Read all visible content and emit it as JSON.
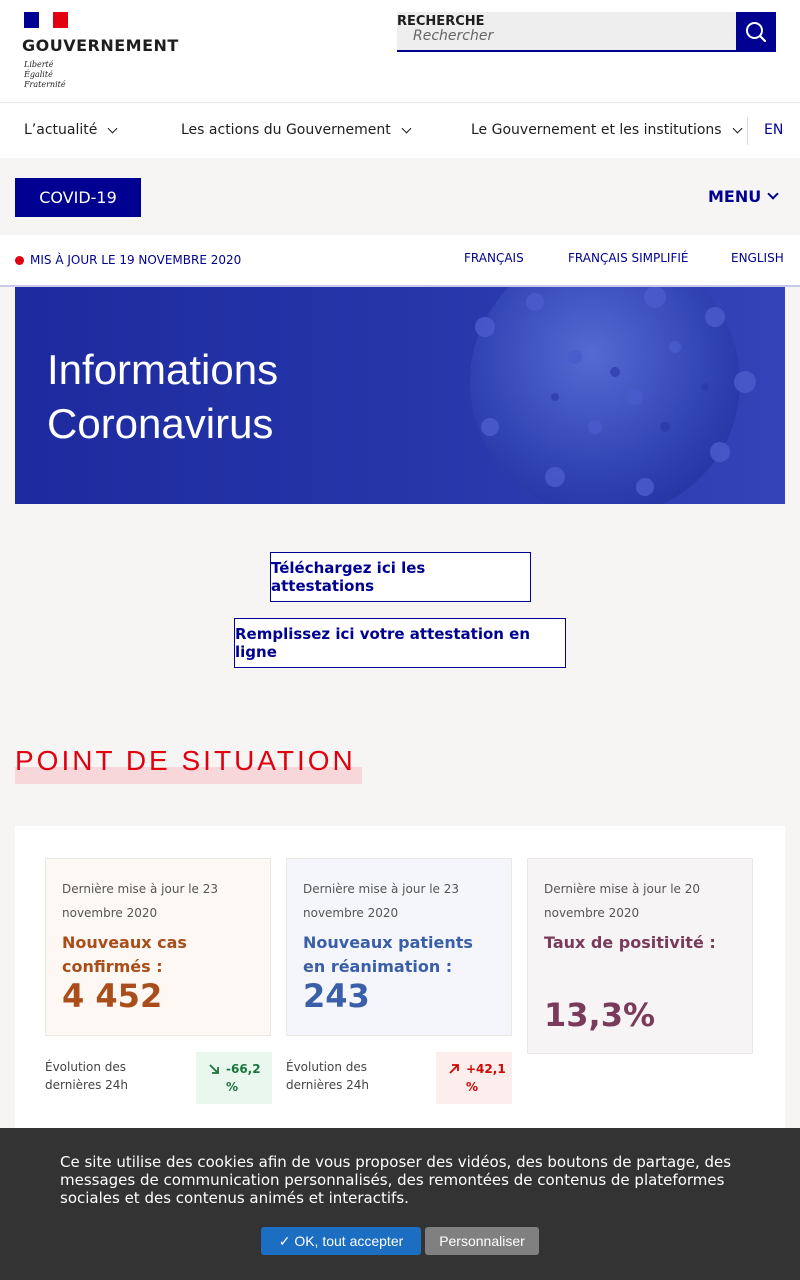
{
  "header": {
    "logo_title": "GOUVERNEMENT",
    "motto": [
      "Liberté",
      "Égalité",
      "Fraternité"
    ],
    "search_label": "RECHERCHE",
    "search_placeholder": "Rechercher"
  },
  "nav": {
    "items": [
      {
        "label": "L’actualité"
      },
      {
        "label": "Les actions du Gouvernement"
      },
      {
        "label": "Le Gouvernement et les institutions"
      }
    ],
    "lang": "EN"
  },
  "covidbar": {
    "tag": "COVID-19",
    "menu": "MENU"
  },
  "updatebar": {
    "text": "MIS À JOUR LE 19 NOVEMBRE 2020",
    "languages": [
      "FRANÇAIS",
      "FRANÇAIS SIMPLIFIÉ",
      "ENGLISH"
    ]
  },
  "hero": {
    "title_line1": "Informations",
    "title_line2": "Coronavirus"
  },
  "actions": {
    "download": "Téléchargez ici les attestations",
    "fill": "Remplissez ici votre attestation en ligne"
  },
  "situation": {
    "title": "POINT DE SITUATION",
    "cards": [
      {
        "date": "Dernière mise à jour le 23 novembre 2020",
        "label": "Nouveaux cas confirmés :",
        "value": "4 452",
        "evolution_text": "Évolution des dernières 24h",
        "evolution_value": "-66,2 %",
        "color": "#a94d1a",
        "bg": "#fdf8f4"
      },
      {
        "date": "Dernière mise à jour le 23 novembre 2020",
        "label": "Nouveaux patients en réanimation :",
        "value": "243",
        "evolution_text": "Évolution des dernières 24h",
        "evolution_value": "+42,1 %",
        "color": "#3a5fa8",
        "bg": "#f4f6fb"
      },
      {
        "date": "Dernière mise à jour le 20 novembre 2020",
        "label": "Taux de positivité :",
        "value": "13,3%",
        "color": "#7a3a5a",
        "bg": "#f7f4f6"
      }
    ]
  },
  "cookie": {
    "text": "Ce site utilise des cookies afin de vous proposer des vidéos, des boutons de partage, des messages de communication personnalisés, des remontées de contenus de plateformes sociales et des contenus animés et interactifs.",
    "accept": "✓ OK, tout accepter",
    "customize": "Personnaliser"
  }
}
